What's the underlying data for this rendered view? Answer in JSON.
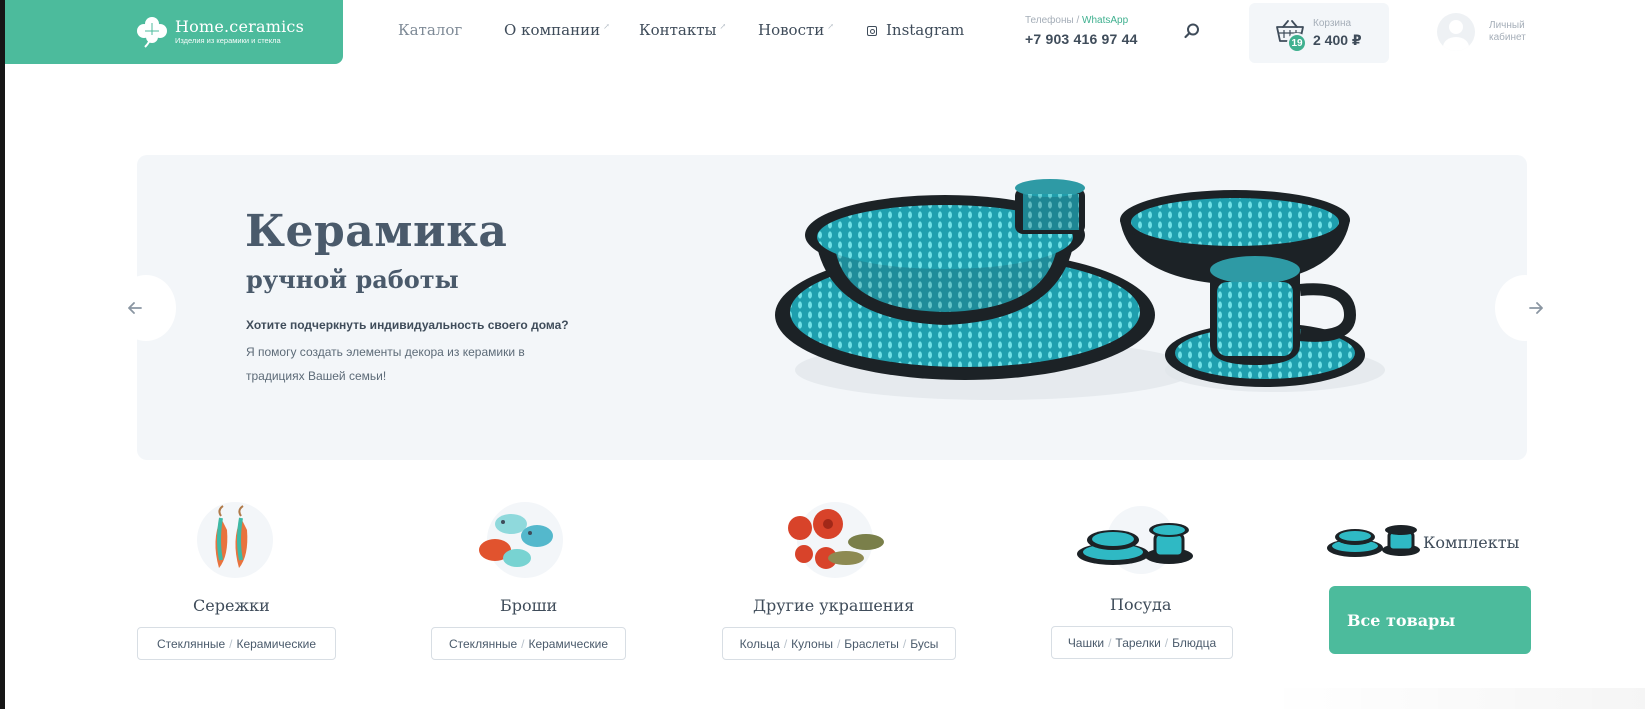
{
  "header": {
    "logo_title": "Home.ceramics",
    "logo_subtitle": "Изделия из керамики и стекла",
    "nav": [
      {
        "label": "Каталог"
      },
      {
        "label": "О компании"
      },
      {
        "label": "Контакты"
      },
      {
        "label": "Новости"
      },
      {
        "label": "Instagram"
      }
    ],
    "phone_label_prefix": "Телефоны / ",
    "phone_label_link": "WhatsApp",
    "phone_number": "+7 903 416 97 44",
    "cart_label": "Корзина",
    "cart_sum": "2 400 ₽",
    "cart_count": "19",
    "account_label": "Личный кабинет"
  },
  "hero": {
    "title": "Керамика",
    "subtitle": "ручной работы",
    "lead": "Хотите подчеркнуть индивидуальность своего дома?",
    "text": "Я помогу создать элементы декора из керамики в традициях Вашей семьи!"
  },
  "categories": [
    {
      "title": "Сережки",
      "chips": [
        "Стеклянные",
        "Керамические"
      ]
    },
    {
      "title": "Броши",
      "chips": [
        "Стеклянные",
        "Керамические"
      ]
    },
    {
      "title": "Другие украшения",
      "chips": [
        "Кольца",
        "Кулоны",
        "Браслеты",
        "Бусы"
      ]
    },
    {
      "title": "Посуда",
      "chips": [
        "Чашки",
        "Тарелки",
        "Блюдца"
      ]
    }
  ],
  "kits_title": "Комплекты",
  "all_goods_label": "Все товары",
  "colors": {
    "accent": "#4cbb9c",
    "hero_bg": "#f3f6f9",
    "ceramic_turquoise": "#2fb9c4",
    "text_dark": "#3f4c5a"
  }
}
